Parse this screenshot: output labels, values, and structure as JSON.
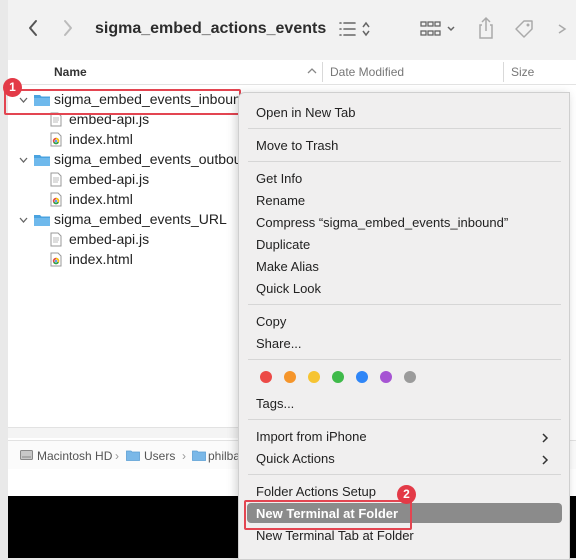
{
  "window": {
    "title": "sigma_embed_actions_events"
  },
  "columns": {
    "name": "Name",
    "date_modified": "Date Modified",
    "size": "Size"
  },
  "tree": [
    {
      "type": "folder",
      "label": "sigma_embed_events_inbound",
      "expanded": true,
      "selected": true
    },
    {
      "type": "file",
      "icon": "js-file-icon",
      "label": "embed-api.js"
    },
    {
      "type": "file",
      "icon": "chrome-html-icon",
      "label": "index.html"
    },
    {
      "type": "folder",
      "label": "sigma_embed_events_outbound",
      "expanded": true
    },
    {
      "type": "file",
      "icon": "js-file-icon",
      "label": "embed-api.js"
    },
    {
      "type": "file",
      "icon": "chrome-html-icon",
      "label": "index.html"
    },
    {
      "type": "folder",
      "label": "sigma_embed_events_URL",
      "expanded": true
    },
    {
      "type": "file",
      "icon": "js-file-icon",
      "label": "embed-api.js"
    },
    {
      "type": "file",
      "icon": "chrome-html-icon",
      "label": "index.html"
    }
  ],
  "pathbar": {
    "items": [
      "Macintosh HD",
      "Users",
      "philba"
    ]
  },
  "annotations": {
    "badge1": "1",
    "badge2": "2"
  },
  "context_menu": {
    "groups": [
      [
        "Open in New Tab"
      ],
      [
        "Move to Trash"
      ],
      [
        "Get Info",
        "Rename",
        "Compress “sigma_embed_events_inbound”",
        "Duplicate",
        "Make Alias",
        "Quick Look"
      ],
      [
        "Copy",
        "Share..."
      ],
      [
        "Tags..."
      ],
      [
        "Import from iPhone",
        "Quick Actions"
      ],
      [
        "Folder Actions Setup",
        "New Terminal at Folder",
        "New Terminal Tab at Folder"
      ]
    ],
    "tag_colors": [
      "#ec4a47",
      "#f5952b",
      "#f6c432",
      "#3fba4a",
      "#2f86f7",
      "#a654d3",
      "#9b9b9b"
    ],
    "highlighted_item": "New Terminal at Folder"
  },
  "colors": {
    "folder": "#4aa3e0",
    "annotation": "#e34551",
    "menu_highlight": "#8b8b8b"
  }
}
